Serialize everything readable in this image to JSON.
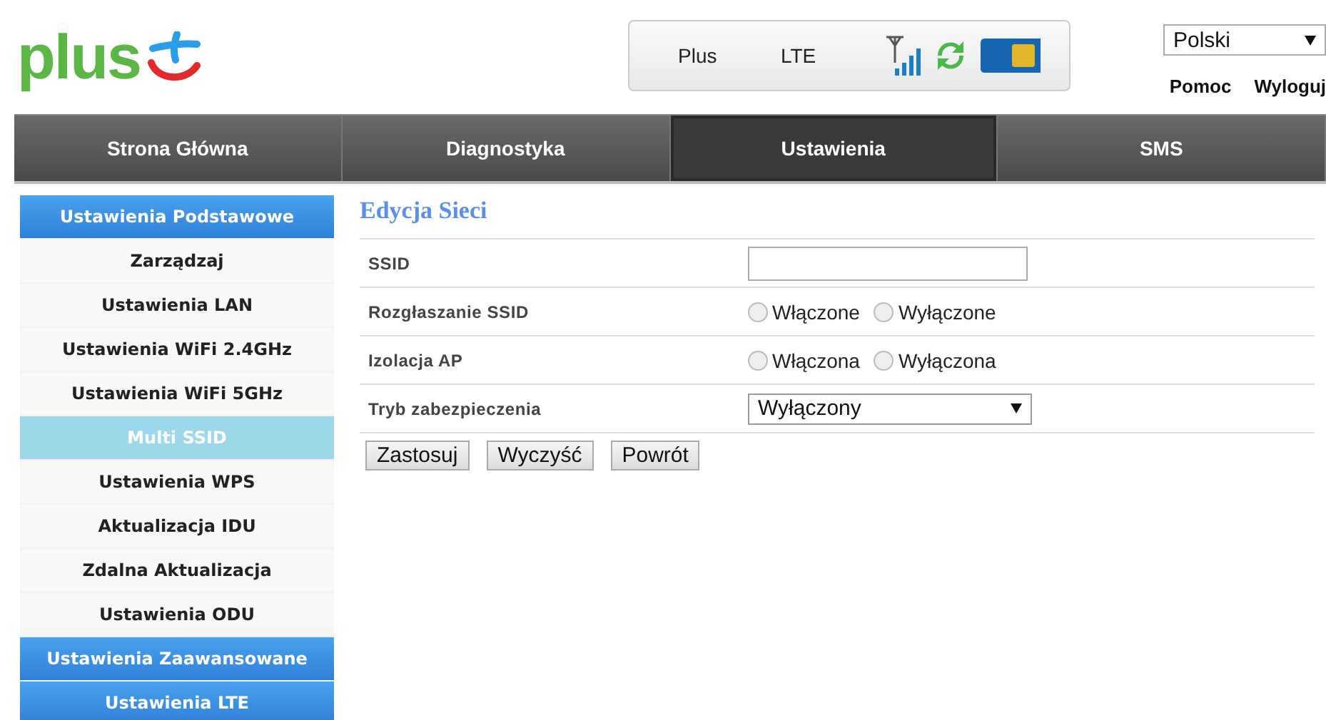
{
  "logo": {
    "text": "plus"
  },
  "status": {
    "operator": "Plus",
    "network": "LTE"
  },
  "language": {
    "value": "Polski"
  },
  "links": [
    "Pomoc",
    "Wyloguj"
  ],
  "nav": [
    {
      "label": "Strona Główna",
      "selected": false
    },
    {
      "label": "Diagnostyka",
      "selected": false
    },
    {
      "label": "Ustawienia",
      "selected": true
    },
    {
      "label": "SMS",
      "selected": false
    }
  ],
  "sidebar": [
    {
      "kind": "header",
      "label": "Ustawienia Podstawowe",
      "selected": false
    },
    {
      "kind": "item",
      "label": "Zarządzaj",
      "selected": false
    },
    {
      "kind": "item",
      "label": "Ustawienia LAN",
      "selected": false
    },
    {
      "kind": "item",
      "label": "Ustawienia WiFi 2.4GHz",
      "selected": false
    },
    {
      "kind": "item",
      "label": "Ustawienia WiFi 5GHz",
      "selected": false
    },
    {
      "kind": "item",
      "label": "Multi SSID",
      "selected": true
    },
    {
      "kind": "item",
      "label": "Ustawienia WPS",
      "selected": false
    },
    {
      "kind": "item",
      "label": "Aktualizacja IDU",
      "selected": false
    },
    {
      "kind": "item",
      "label": "Zdalna Aktualizacja",
      "selected": false
    },
    {
      "kind": "item",
      "label": "Ustawienia ODU",
      "selected": false
    },
    {
      "kind": "header",
      "label": "Ustawienia Zaawansowane",
      "selected": false
    },
    {
      "kind": "header",
      "label": "Ustawienia LTE",
      "selected": false
    }
  ],
  "form": {
    "title": "Edycja Sieci",
    "rows": [
      {
        "kind": "text",
        "label": "SSID"
      },
      {
        "kind": "radio",
        "label": "Rozgłaszanie SSID",
        "options": [
          {
            "label": "Włączone",
            "selected": false
          },
          {
            "label": "Wyłączone",
            "selected": false
          }
        ]
      },
      {
        "kind": "radio",
        "label": "Izolacja AP",
        "options": [
          {
            "label": "Włączona",
            "selected": false
          },
          {
            "label": "Wyłączona",
            "selected": false
          }
        ]
      },
      {
        "kind": "select",
        "label": "Tryb zabezpieczenia",
        "value": "Wyłączony"
      }
    ],
    "buttons": [
      "Zastosuj",
      "Wyczyść",
      "Powrót"
    ]
  }
}
